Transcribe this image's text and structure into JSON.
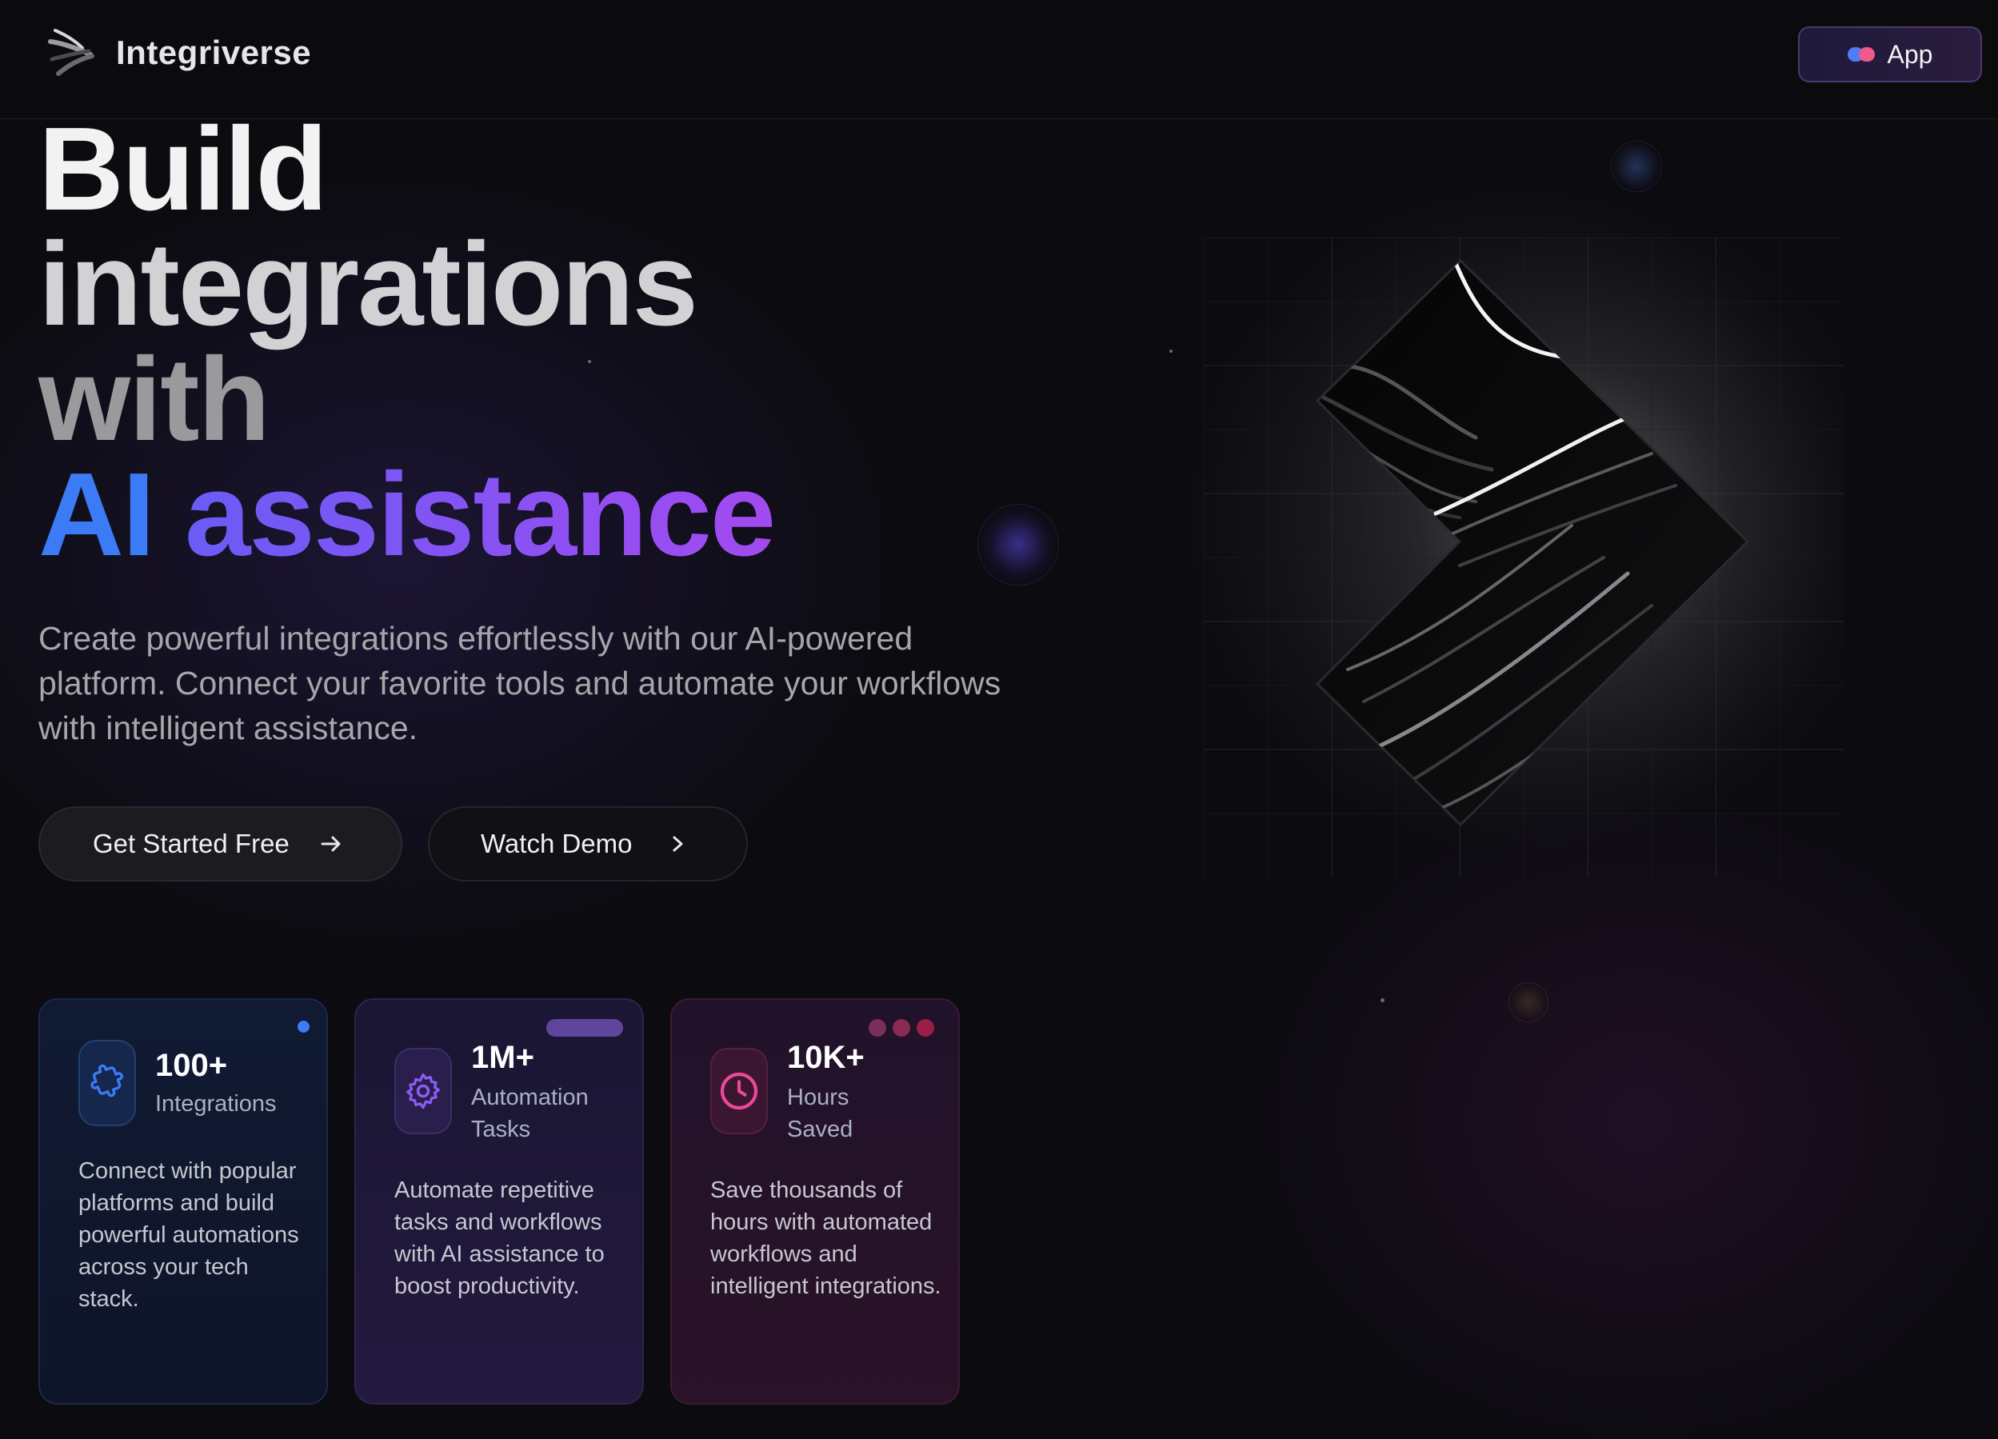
{
  "nav": {
    "brand": "Integriverse",
    "app_button_label": "App"
  },
  "hero": {
    "line1": "Build",
    "line2": "integrations",
    "line3": "with",
    "line4_ai": "AI",
    "line4_rest": "assistance",
    "subtitle": "Create powerful integrations effortlessly with our AI-powered platform. Connect your favorite tools and automate your workflows with intelligent assistance.",
    "primary_button": "Get Started Free",
    "secondary_button": "Watch Demo"
  },
  "stats": [
    {
      "value": "100+",
      "label": "Integrations",
      "description": "Connect with popular platforms and build powerful automations across your tech stack.",
      "icon": "puzzle-icon",
      "accent": "#3b7bf6"
    },
    {
      "value": "1M+",
      "label": "Automation Tasks",
      "description": "Automate repetitive tasks and workflows with AI assistance to boost productivity.",
      "icon": "gear-icon",
      "accent": "#8b5cf6"
    },
    {
      "value": "10K+",
      "label": "Hours Saved",
      "description": "Save thousands of hours with automated workflows and intelligent integrations.",
      "icon": "clock-icon",
      "accent": "#ec4899"
    }
  ],
  "colors": {
    "background": "#0c0b10",
    "ai_blue": "#3b7bf6",
    "gradient_start": "#6a5cf5",
    "gradient_end": "#a24af0"
  }
}
